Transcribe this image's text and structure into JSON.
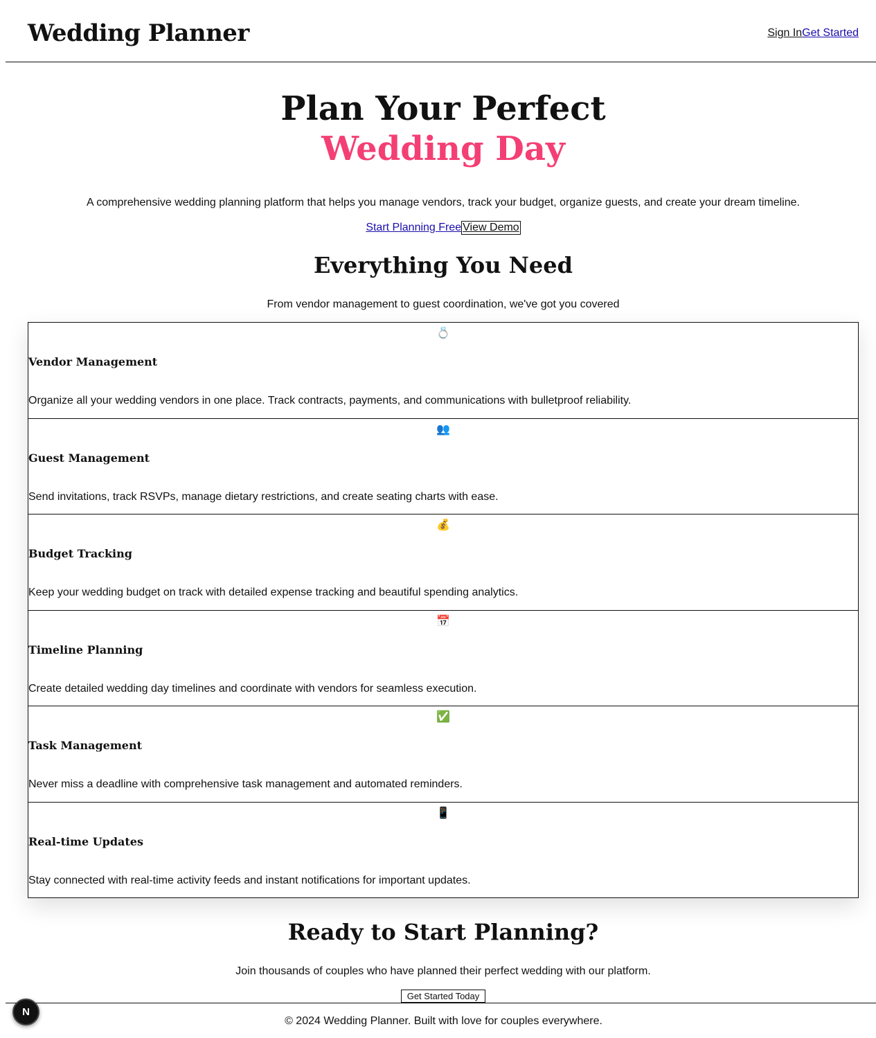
{
  "header": {
    "brand": "Wedding Planner",
    "signin": "Sign In",
    "getstarted": "Get Started"
  },
  "hero": {
    "title_line1": "Plan Your Perfect",
    "title_line2": "Wedding Day",
    "subtitle": "A comprehensive wedding planning platform that helps you manage vendors, track your budget, organize guests, and create your dream timeline.",
    "primary_cta": "Start Planning Free",
    "secondary_cta": "View Demo"
  },
  "features": {
    "title": "Everything You Need",
    "subtitle": "From vendor management to guest coordination, we've got you covered",
    "items": [
      {
        "icon": "💍",
        "icon_name": "ring-icon",
        "title": "Vendor Management",
        "desc": "Organize all your wedding vendors in one place. Track contracts, payments, and communications with bulletproof reliability."
      },
      {
        "icon": "👥",
        "icon_name": "people-icon",
        "title": "Guest Management",
        "desc": "Send invitations, track RSVPs, manage dietary restrictions, and create seating charts with ease."
      },
      {
        "icon": "💰",
        "icon_name": "money-bag-icon",
        "title": "Budget Tracking",
        "desc": "Keep your wedding budget on track with detailed expense tracking and beautiful spending analytics."
      },
      {
        "icon": "📅",
        "icon_name": "calendar-icon",
        "title": "Timeline Planning",
        "desc": "Create detailed wedding day timelines and coordinate with vendors for seamless execution."
      },
      {
        "icon": "✅",
        "icon_name": "checkmark-icon",
        "title": "Task Management",
        "desc": "Never miss a deadline with comprehensive task management and automated reminders."
      },
      {
        "icon": "📱",
        "icon_name": "mobile-phone-icon",
        "title": "Real-time Updates",
        "desc": "Stay connected with real-time activity feeds and instant notifications for important updates."
      }
    ]
  },
  "cta": {
    "title": "Ready to Start Planning?",
    "subtitle": "Join thousands of couples who have planned their perfect wedding with our platform.",
    "button": "Get Started Today"
  },
  "footer": {
    "text": "© 2024 Wedding Planner. Built with love for couples everywhere."
  },
  "badge": {
    "letter": "N"
  },
  "colors": {
    "accent": "#f43f74",
    "link": "#1a0dab",
    "text": "#111111"
  }
}
